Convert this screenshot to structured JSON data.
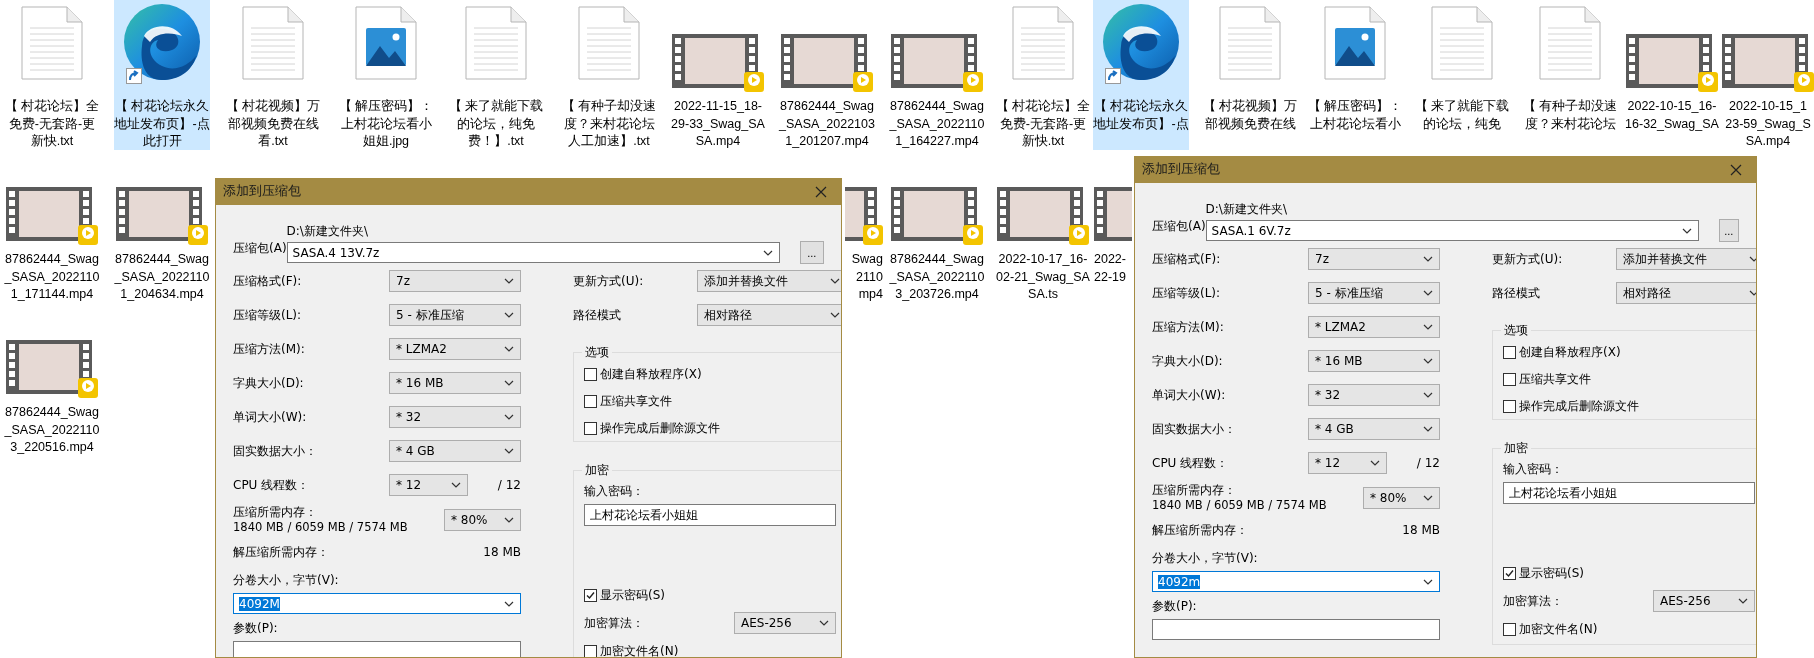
{
  "desktop": {
    "rows": [
      [
        {
          "kind": "text",
          "lines": [
            "【 村花论坛】全",
            "免费-无套路-更",
            "新快.txt"
          ],
          "selected": false
        },
        {
          "kind": "shortcut",
          "lines": [
            "【 村花论坛永久",
            "地址发布页】-点",
            "此打开"
          ],
          "selected": true
        },
        {
          "kind": "text",
          "lines": [
            "【 村花视频】万",
            "部视频免费在线",
            "看.txt"
          ],
          "selected": false
        },
        {
          "kind": "image",
          "lines": [
            "【 解压密码】：",
            "上村花论坛看小",
            "姐姐.jpg"
          ],
          "selected": false
        },
        {
          "kind": "text",
          "lines": [
            "【 来了就能下载",
            "的论坛，纯免",
            "费！】.txt"
          ],
          "selected": false
        },
        {
          "kind": "text",
          "lines": [
            "【 有种子却没速",
            "度？来村花论坛",
            "人工加速】.txt"
          ],
          "selected": false
        },
        {
          "kind": "video",
          "lines": [
            "2022-11-15_18-",
            "29-33_Swag_SA",
            "SA.mp4"
          ],
          "selected": false
        },
        {
          "kind": "video",
          "lines": [
            "87862444_Swag",
            "_SASA_2022103",
            "1_201207.mp4"
          ],
          "selected": false
        },
        {
          "kind": "video",
          "lines": [
            "87862444_Swag",
            "_SASA_2022110",
            "1_164227.mp4"
          ],
          "selected": false
        },
        {
          "kind": "text",
          "lines": [
            "【 村花论坛】全",
            "免费-无套路-更",
            "新快.txt"
          ],
          "selected": false
        },
        {
          "kind": "shortcut",
          "lines": [
            "【 村花论坛永久",
            "地址发布页】-点"
          ],
          "selected": true
        },
        {
          "kind": "text",
          "lines": [
            "【 村花视频】万",
            "部视频免费在线"
          ],
          "selected": false
        },
        {
          "kind": "image",
          "lines": [
            "【 解压密码】：",
            "上村花论坛看小"
          ],
          "selected": false
        },
        {
          "kind": "text",
          "lines": [
            "【 来了就能下载",
            "的论坛，纯免"
          ],
          "selected": false
        },
        {
          "kind": "text",
          "lines": [
            "【 有种子却没速",
            "度？来村花论坛"
          ],
          "selected": false
        },
        {
          "kind": "video",
          "lines": [
            "2022-10-15_16-",
            "16-32_Swag_SA"
          ],
          "selected": false
        },
        {
          "kind": "video",
          "lines": [
            "2022-10-15_1",
            "23-59_Swag_S",
            "SA.mp4"
          ],
          "selected": false
        }
      ],
      [
        {
          "kind": "video",
          "lines": [
            "87862444_Swag",
            "_SASA_2022110",
            "1_171144.mp4"
          ],
          "selected": false
        },
        {
          "kind": "video",
          "lines": [
            "87862444_Swag",
            "_SASA_2022110",
            "1_204634.mp4"
          ],
          "selected": false
        },
        "",
        "",
        "",
        "",
        "",
        {
          "kind": "video",
          "lines": [
            "Swag",
            "2110",
            "mp4"
          ],
          "selected": false
        },
        {
          "kind": "video",
          "lines": [
            "87862444_Swag",
            "_SASA_2022110",
            "3_203726.mp4"
          ],
          "selected": false
        },
        {
          "kind": "video",
          "lines": [
            "2022-10-17_16-",
            "02-21_Swag_SA",
            "SA.ts"
          ],
          "selected": false
        },
        {
          "kind": "video",
          "lines": [
            "2022-",
            "22-19"
          ],
          "selected": false
        }
      ],
      [
        {
          "kind": "video",
          "lines": [
            "87862444_Swag",
            "_SASA_2022110",
            "3_220516.mp4"
          ],
          "selected": false
        }
      ]
    ]
  },
  "dialogs": [
    {
      "title": "添加到压缩包",
      "archive": {
        "label": "压缩包(A)",
        "folder": "D:\\新建文件夹\\",
        "value": "SASA.4 13V.7z",
        "browse": "..."
      },
      "settings": [
        {
          "label": "压缩格式(F):",
          "value": "7z"
        },
        {
          "label": "压缩等级(L):",
          "value": "5 - 标准压缩"
        },
        {
          "label": "压缩方法(M):",
          "value": "* LZMA2"
        },
        {
          "label": "字典大小(D):",
          "value": "* 16 MB"
        },
        {
          "label": "单词大小(W):",
          "value": "* 32"
        },
        {
          "label": "固实数据大小：",
          "value": "* 4 GB"
        }
      ],
      "threads": {
        "label": "CPU 线程数：",
        "value": "* 12",
        "total": "/ 12"
      },
      "memory": {
        "label": "压缩所需内存：",
        "usage": "1840 MB / 6059 MB / 7574 MB",
        "value": "* 80%"
      },
      "decompress": {
        "label": "解压缩所需内存：",
        "value": "18 MB"
      },
      "volume": {
        "label": "分卷大小，字节(V):",
        "value": "4092M",
        "focused": true
      },
      "parameters": {
        "label": "参数(P):"
      },
      "update": {
        "label": "更新方式(U):",
        "value": "添加并替换文件"
      },
      "path_mode": {
        "label": "路径模式",
        "value": "相对路径"
      },
      "options": {
        "title": "选项",
        "items": [
          {
            "label": "创建自释放程序(X)",
            "checked": false
          },
          {
            "label": "压缩共享文件",
            "checked": false
          },
          {
            "label": "操作完成后删除源文件",
            "checked": false
          }
        ]
      },
      "encryption": {
        "title": "加密",
        "password_label": "输入密码：",
        "password": "上村花论坛看小姐姐",
        "show_password": {
          "label": "显示密码(S)",
          "checked": true
        },
        "method_label": "加密算法：",
        "method": "AES-256",
        "encrypt_names": {
          "label": "加密文件名(N)",
          "checked": false
        }
      }
    },
    {
      "title": "添加到压缩包",
      "archive": {
        "label": "压缩包(A)",
        "folder": "D:\\新建文件夹\\",
        "value": "SASA.1 6V.7z",
        "browse": "..."
      },
      "settings": [
        {
          "label": "压缩格式(F):",
          "value": "7z"
        },
        {
          "label": "压缩等级(L):",
          "value": "5 - 标准压缩"
        },
        {
          "label": "压缩方法(M):",
          "value": "* LZMA2"
        },
        {
          "label": "字典大小(D):",
          "value": "* 16 MB"
        },
        {
          "label": "单词大小(W):",
          "value": "* 32"
        },
        {
          "label": "固实数据大小：",
          "value": "* 4 GB"
        }
      ],
      "threads": {
        "label": "CPU 线程数：",
        "value": "* 12",
        "total": "/ 12"
      },
      "memory": {
        "label": "压缩所需内存：",
        "usage": "1840 MB / 6059 MB / 7574 MB",
        "value": "* 80%"
      },
      "decompress": {
        "label": "解压缩所需内存：",
        "value": "18 MB"
      },
      "volume": {
        "label": "分卷大小，字节(V):",
        "value": "4092m",
        "focused": true
      },
      "parameters": {
        "label": "参数(P):"
      },
      "update": {
        "label": "更新方式(U):",
        "value": "添加并替换文件"
      },
      "path_mode": {
        "label": "路径模式",
        "value": "相对路径"
      },
      "options": {
        "title": "选项",
        "items": [
          {
            "label": "创建自释放程序(X)",
            "checked": false
          },
          {
            "label": "压缩共享文件",
            "checked": false
          },
          {
            "label": "操作完成后删除源文件",
            "checked": false
          }
        ]
      },
      "encryption": {
        "title": "加密",
        "password_label": "输入密码：",
        "password": "上村花论坛看小姐姐",
        "show_password": {
          "label": "显示密码(S)",
          "checked": true
        },
        "method_label": "加密算法：",
        "method": "AES-256",
        "encrypt_names": {
          "label": "加密文件名(N)",
          "checked": false
        }
      }
    }
  ]
}
